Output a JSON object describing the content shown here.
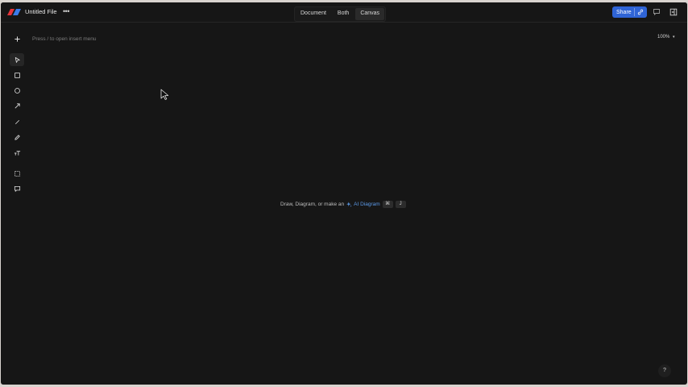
{
  "header": {
    "file_title": "Untitled File",
    "more_label": "•••",
    "view_tabs": [
      {
        "label": "Document"
      },
      {
        "label": "Both"
      },
      {
        "label": "Canvas"
      }
    ],
    "active_view": "Canvas",
    "share_label": "Share"
  },
  "canvas": {
    "insert_hint": "Press / to open insert menu",
    "zoom_label": "100%",
    "center_prefix": "Draw, Diagram, or make an",
    "ai_diagram_label": "AI Diagram",
    "shortcut_modifier": "⌘",
    "shortcut_key": "J",
    "help_label": "?"
  },
  "toolbar": {
    "tools": [
      {
        "name": "add-icon"
      },
      {
        "name": "select-icon"
      },
      {
        "name": "rectangle-icon"
      },
      {
        "name": "circle-icon"
      },
      {
        "name": "arrow-icon"
      },
      {
        "name": "line-icon"
      },
      {
        "name": "pencil-icon"
      },
      {
        "name": "text-icon"
      },
      {
        "name": "frame-icon"
      },
      {
        "name": "comment-icon"
      }
    ],
    "active_tool": "select-icon"
  },
  "colors": {
    "background": "#161616",
    "accent": "#2f64d6",
    "link": "#5c9ae8"
  }
}
